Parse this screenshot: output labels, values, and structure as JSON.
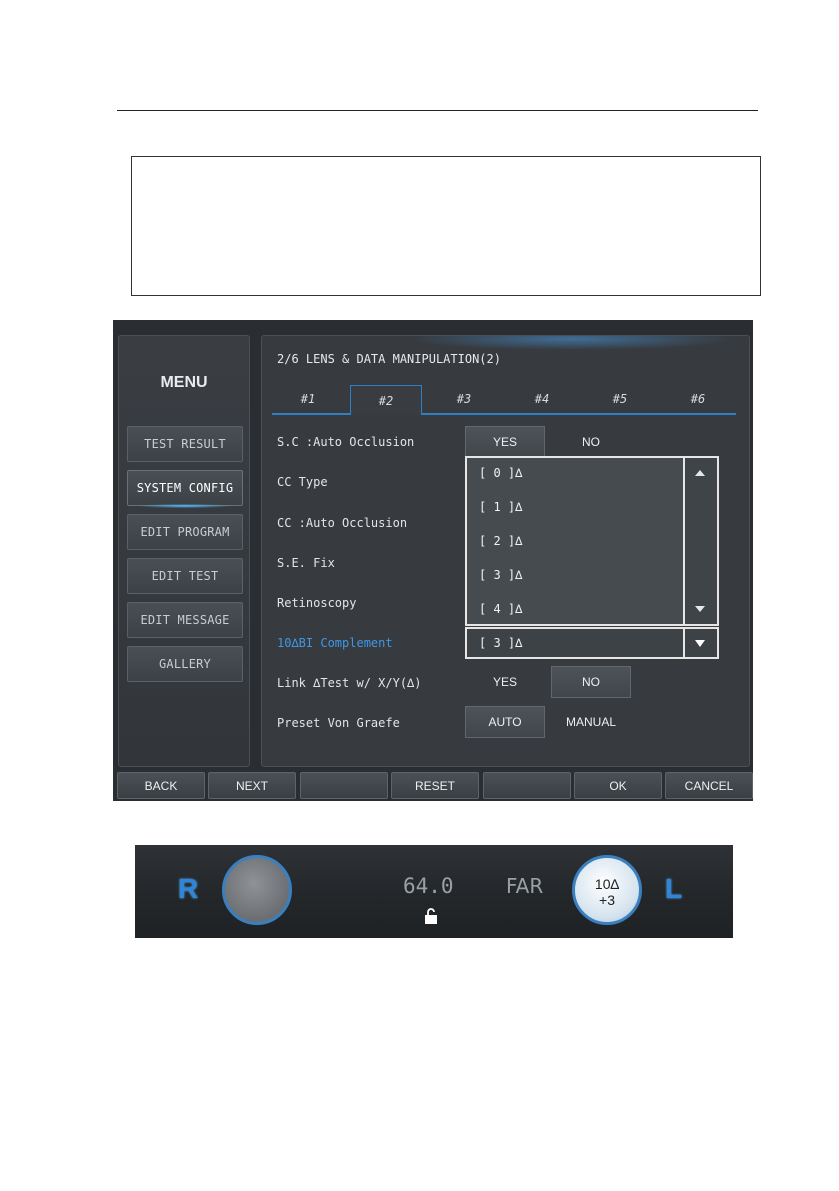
{
  "screen": {
    "menu_title": "MENU",
    "side_items": [
      {
        "label": "TEST RESULT"
      },
      {
        "label": "SYSTEM CONFIG",
        "active": true
      },
      {
        "label": "EDIT PROGRAM"
      },
      {
        "label": "EDIT TEST"
      },
      {
        "label": "EDIT MESSAGE"
      },
      {
        "label": "GALLERY"
      }
    ],
    "panel_title": "2/6  LENS & DATA MANIPULATION(2)",
    "tabs": [
      "#1",
      "#2",
      "#3",
      "#4",
      "#5",
      "#6"
    ],
    "active_tab": "#2",
    "rows": [
      {
        "label": "S.C :Auto Occlusion",
        "opt1": "YES",
        "opt2": "NO",
        "selected": "YES"
      },
      {
        "label": "CC Type"
      },
      {
        "label": "CC :Auto Occlusion"
      },
      {
        "label": "S.E. Fix"
      },
      {
        "label": "Retinoscopy"
      },
      {
        "label": "10∆BI Complement",
        "highlight": true
      },
      {
        "label": "Link ∆Test w/ X/Y(∆)",
        "opt1": "YES",
        "opt2": "NO",
        "selected": "NO"
      },
      {
        "label": "Preset Von Graefe",
        "opt1": "AUTO",
        "opt2": "MANUAL",
        "selected": "AUTO"
      }
    ],
    "dropdown_options": [
      "[ 0 ]∆",
      "[ 1 ]∆",
      "[ 2 ]∆",
      "[ 3 ]∆",
      "[ 4 ]∆"
    ],
    "dropdown_selected": "[ 3 ]∆",
    "bottom_buttons": [
      "BACK",
      "NEXT",
      "",
      "RESET",
      "",
      "OK",
      "CANCEL"
    ]
  },
  "status_strip": {
    "right_eye_label": "R",
    "left_eye_label": "L",
    "pd_value": "64.0",
    "distance": "FAR",
    "left_prism": "10∆",
    "left_prism_base": "+3",
    "lock_icon": "unlock-icon",
    "accent_color": "#2f86d9"
  }
}
